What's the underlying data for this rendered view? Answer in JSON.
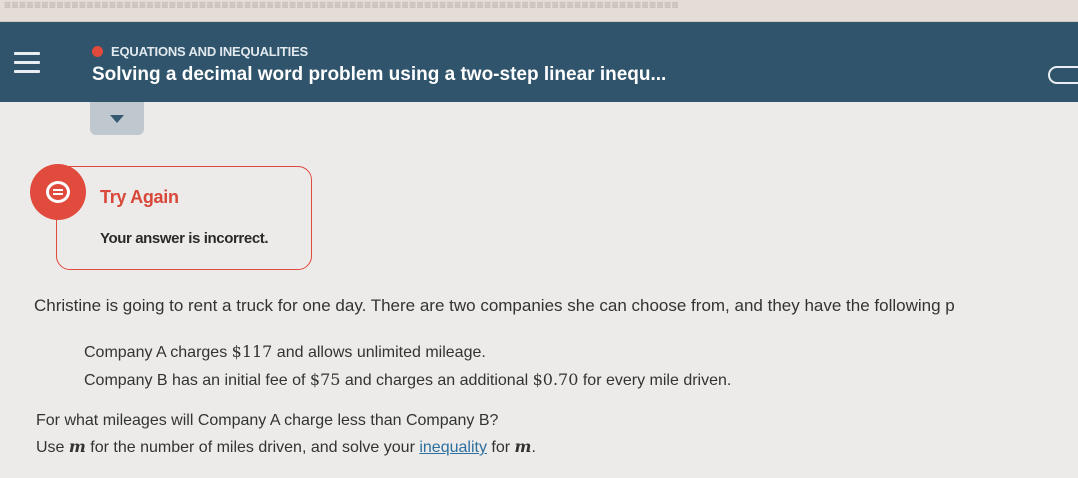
{
  "header": {
    "topic": "EQUATIONS AND INEQUALITIES",
    "title": "Solving a decimal word problem using a two-step linear inequ..."
  },
  "feedback": {
    "title": "Try Again",
    "message": "Your answer is incorrect."
  },
  "problem": {
    "intro": "Christine is going to rent a truck for one day. There are two companies she can choose from, and they have the following p",
    "company_a": {
      "before": "Company A charges ",
      "price": "$117",
      "after": " and allows unlimited mileage."
    },
    "company_b": {
      "before": "Company B has an initial fee of ",
      "fee": "$75",
      "middle": " and charges an additional ",
      "rate": "$0.70",
      "after": " for every mile driven."
    },
    "question": "For what mileages will Company A charge less than Company B?",
    "instruction": {
      "use": "Use ",
      "var": "m",
      "middle": " for the number of miles driven, and solve your ",
      "link": "inequality",
      "for": " for ",
      "var2": "m",
      "end": "."
    }
  },
  "colors": {
    "header_bg": "#2f546b",
    "accent_red": "#e04a3c",
    "link_blue": "#2d6f9f"
  },
  "icons": {
    "menu": "hamburger-menu-icon",
    "feedback": "chat-bubble-icon",
    "dropdown": "caret-down-icon",
    "topic_dot": "status-dot-icon"
  }
}
